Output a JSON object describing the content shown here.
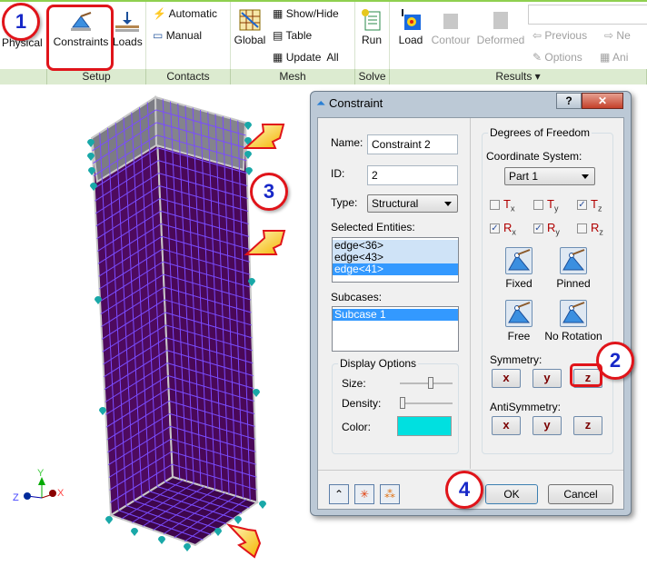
{
  "ribbon": {
    "setup": {
      "label": "Setup",
      "physical": "Physical",
      "constraints": "Constraints",
      "loads": "Loads"
    },
    "contacts": {
      "label": "Contacts",
      "automatic": "Automatic",
      "manual": "Manual"
    },
    "mesh": {
      "label": "Mesh",
      "global": "Global",
      "show_hide": "Show/Hide",
      "table": "Table",
      "update_all": "Update  All"
    },
    "solve": {
      "label": "Solve",
      "run": "Run"
    },
    "results": {
      "label": "Results ▾",
      "load": "Load",
      "contour": "Contour",
      "deformed": "Deformed",
      "previous": "Previous",
      "next": "Ne",
      "options": "Options",
      "animate": "Ani"
    }
  },
  "viewport": {
    "axes": {
      "x": "X",
      "y": "Y",
      "z": "Z"
    },
    "mesh_color": "#4e0a5e",
    "grid_color": "#7a4cff",
    "constraint_marker_color": "#19a8a8"
  },
  "dialog": {
    "title": "Constraint",
    "help": "?",
    "close": "✕",
    "name_label": "Name:",
    "name_value": "Constraint 2",
    "id_label": "ID:",
    "id_value": "2",
    "type_label": "Type:",
    "type_value": "Structural",
    "selected_label": "Selected Entities:",
    "selected": [
      "edge<36>",
      "edge<43>",
      "edge<41>"
    ],
    "subcases_label": "Subcases:",
    "subcases": [
      "Subcase 1"
    ],
    "display": {
      "legend": "Display Options",
      "size_label": "Size:",
      "size_value": 0.6,
      "density_label": "Density:",
      "density_value": 0.0,
      "color_label": "Color:",
      "color": "#00e0e0"
    },
    "dof": {
      "legend": "Degrees of Freedom",
      "coord_label": "Coordinate System:",
      "coord_value": "Part 1",
      "checks": [
        {
          "l": "T",
          "s": "x",
          "checked": false
        },
        {
          "l": "T",
          "s": "y",
          "checked": false
        },
        {
          "l": "T",
          "s": "z",
          "checked": true
        },
        {
          "l": "R",
          "s": "x",
          "checked": true
        },
        {
          "l": "R",
          "s": "y",
          "checked": true
        },
        {
          "l": "R",
          "s": "z",
          "checked": false
        }
      ],
      "presets": [
        "Fixed",
        "Pinned",
        "Free",
        "No Rotation"
      ]
    },
    "symmetry_label": "Symmetry:",
    "symmetry": [
      "x",
      "y",
      "z"
    ],
    "antisymmetry_label": "AntiSymmetry:",
    "antisymmetry": [
      "x",
      "y",
      "z"
    ],
    "ok": "OK",
    "cancel": "Cancel"
  },
  "callouts": [
    "1",
    "2",
    "3",
    "4"
  ],
  "accent": "#e0141a"
}
